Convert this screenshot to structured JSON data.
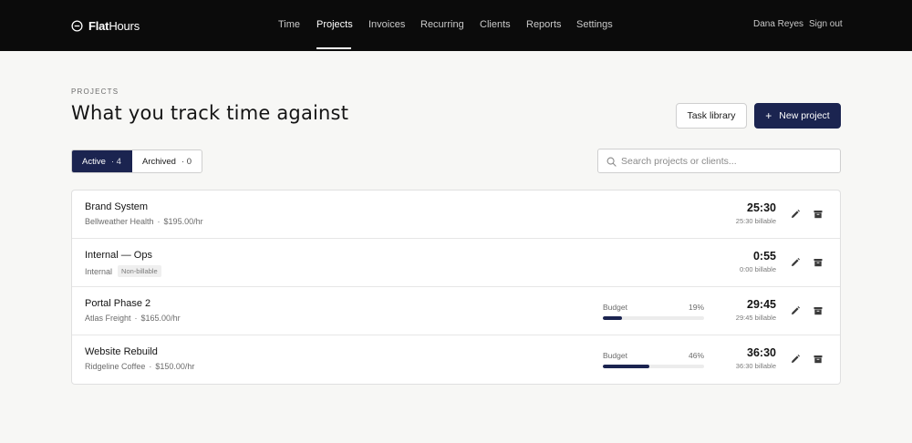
{
  "app": {
    "brand_bold": "Flat",
    "brand_light": "Hours",
    "brand_icon": "minus-circle-icon"
  },
  "nav": {
    "items": [
      {
        "label": "Time",
        "active": false
      },
      {
        "label": "Projects",
        "active": true
      },
      {
        "label": "Invoices",
        "active": false
      },
      {
        "label": "Recurring",
        "active": false
      },
      {
        "label": "Clients",
        "active": false
      },
      {
        "label": "Reports",
        "active": false
      },
      {
        "label": "Settings",
        "active": false
      }
    ],
    "user_name": "Dana Reyes",
    "sign_out": "Sign out"
  },
  "header": {
    "eyebrow": "PROJECTS",
    "title": "What you track time against",
    "task_library_label": "Task library",
    "new_project_label": "New project",
    "new_project_icon": "plus-icon"
  },
  "tabs": {
    "active": {
      "label": "Active",
      "count": "· 4"
    },
    "archived": {
      "label": "Archived",
      "count": "· 0"
    }
  },
  "search": {
    "placeholder": "Search projects or clients...",
    "value": "",
    "icon": "search-icon"
  },
  "projects": [
    {
      "name": "Brand System",
      "client": "Bellweather Health",
      "rate": "$195.00/hr",
      "badge": null,
      "budget": null,
      "hours": "25:30",
      "billable": "25:30 billable"
    },
    {
      "name": "Internal — Ops",
      "client": "Internal",
      "rate": null,
      "badge": "Non-billable",
      "budget": null,
      "hours": "0:55",
      "billable": "0:00 billable"
    },
    {
      "name": "Portal Phase 2",
      "client": "Atlas Freight",
      "rate": "$165.00/hr",
      "badge": null,
      "budget": {
        "label": "Budget",
        "percent": 19,
        "percent_label": "19%"
      },
      "hours": "29:45",
      "billable": "29:45 billable"
    },
    {
      "name": "Website Rebuild",
      "client": "Ridgeline Coffee",
      "rate": "$150.00/hr",
      "badge": null,
      "budget": {
        "label": "Budget",
        "percent": 46,
        "percent_label": "46%"
      },
      "hours": "36:30",
      "billable": "36:30 billable"
    }
  ],
  "row_actions": {
    "edit_icon": "pencil-icon",
    "archive_icon": "archive-box-icon"
  },
  "colors": {
    "topbar": "#0b0b0b",
    "accent": "#1b2450",
    "page_bg": "#f7f7f5"
  }
}
